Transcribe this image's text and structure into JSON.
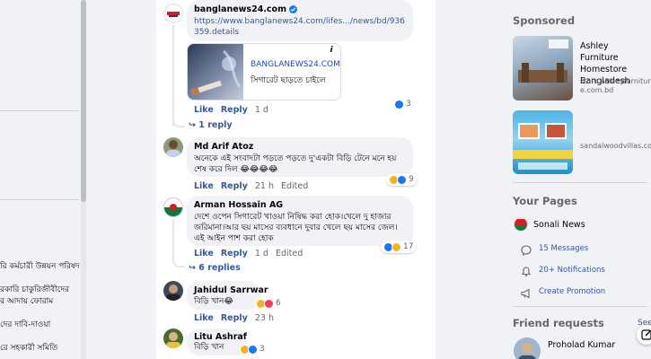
{
  "left": {
    "items": [
      "রি কর্মচারী উন্নয়ন পরিষদ",
      "রকারি চাকুরিজীবীদের",
      "র আদায় ফোরাম",
      "দের দাবি-দাওয়া",
      "রে সহকারী সমিতি"
    ]
  },
  "post": {
    "link_comment": {
      "author": "banglanews24.com",
      "url": "https://www.banglanews24.com/lifes.../news/bd/936359.details",
      "preview_site": "BANGLANEWS24.COM",
      "preview_title": "সিগারেট ছাড়তে চাইলে",
      "like": "Like",
      "reply": "Reply",
      "time": "1 d",
      "react_count": "3",
      "replies": "1 reply"
    },
    "comments": [
      {
        "author": "Md Arif Atoz",
        "text": "অনেকে এই সংবাদটা পড়তে পড়তে দু'একটা বিড়ি টেনে মনে হয় শেষ করে দিল 😂😂😂😂",
        "like": "Like",
        "reply": "Reply",
        "time": "21 h",
        "edited": "Edited",
        "react_count": "9"
      },
      {
        "author": "Arman Hossain AG",
        "text": "দেশে ওপেন সিগারেট খাওয়া নিষিদ্ধ করা হোক।খেলে দু হাজার জরিমানা।আর ছয় মাসের ব্যবধানে দুবার খেলে ছয় মাসের জেল।এই আইন পাশ করা হোক",
        "like": "Like",
        "reply": "Reply",
        "time": "1 d",
        "edited": "Edited",
        "react_count": "17",
        "replies": "6 replies"
      },
      {
        "author": "Jahidul Sarrwar",
        "text": "বিড়ি খান😂",
        "like": "Like",
        "reply": "Reply",
        "time": "23 h",
        "react_count": "6"
      },
      {
        "author": "Litu Ashraf",
        "text": "বিড়ি খান",
        "react_count": "3"
      }
    ]
  },
  "right": {
    "sponsored": "Sponsored",
    "ad1": {
      "title": "Ashley Furniture Homestore Bangladesh",
      "domain": "store.ashleyfurniture.com.bd"
    },
    "ad2": {
      "domain": "sandalwoodvillas.com"
    },
    "your_pages": "Your Pages",
    "page_name": "Sonali News",
    "messages": "15 Messages",
    "notifications": "20+ Notifications",
    "promotion": "Create Promotion",
    "friend_requests": "Friend requests",
    "see_all": "See",
    "friend_name": "Proholad Kumar"
  },
  "colors": {
    "link": "#385898",
    "muted": "#65676b",
    "bg": "#f0f2f5",
    "like": "#1877f2"
  }
}
